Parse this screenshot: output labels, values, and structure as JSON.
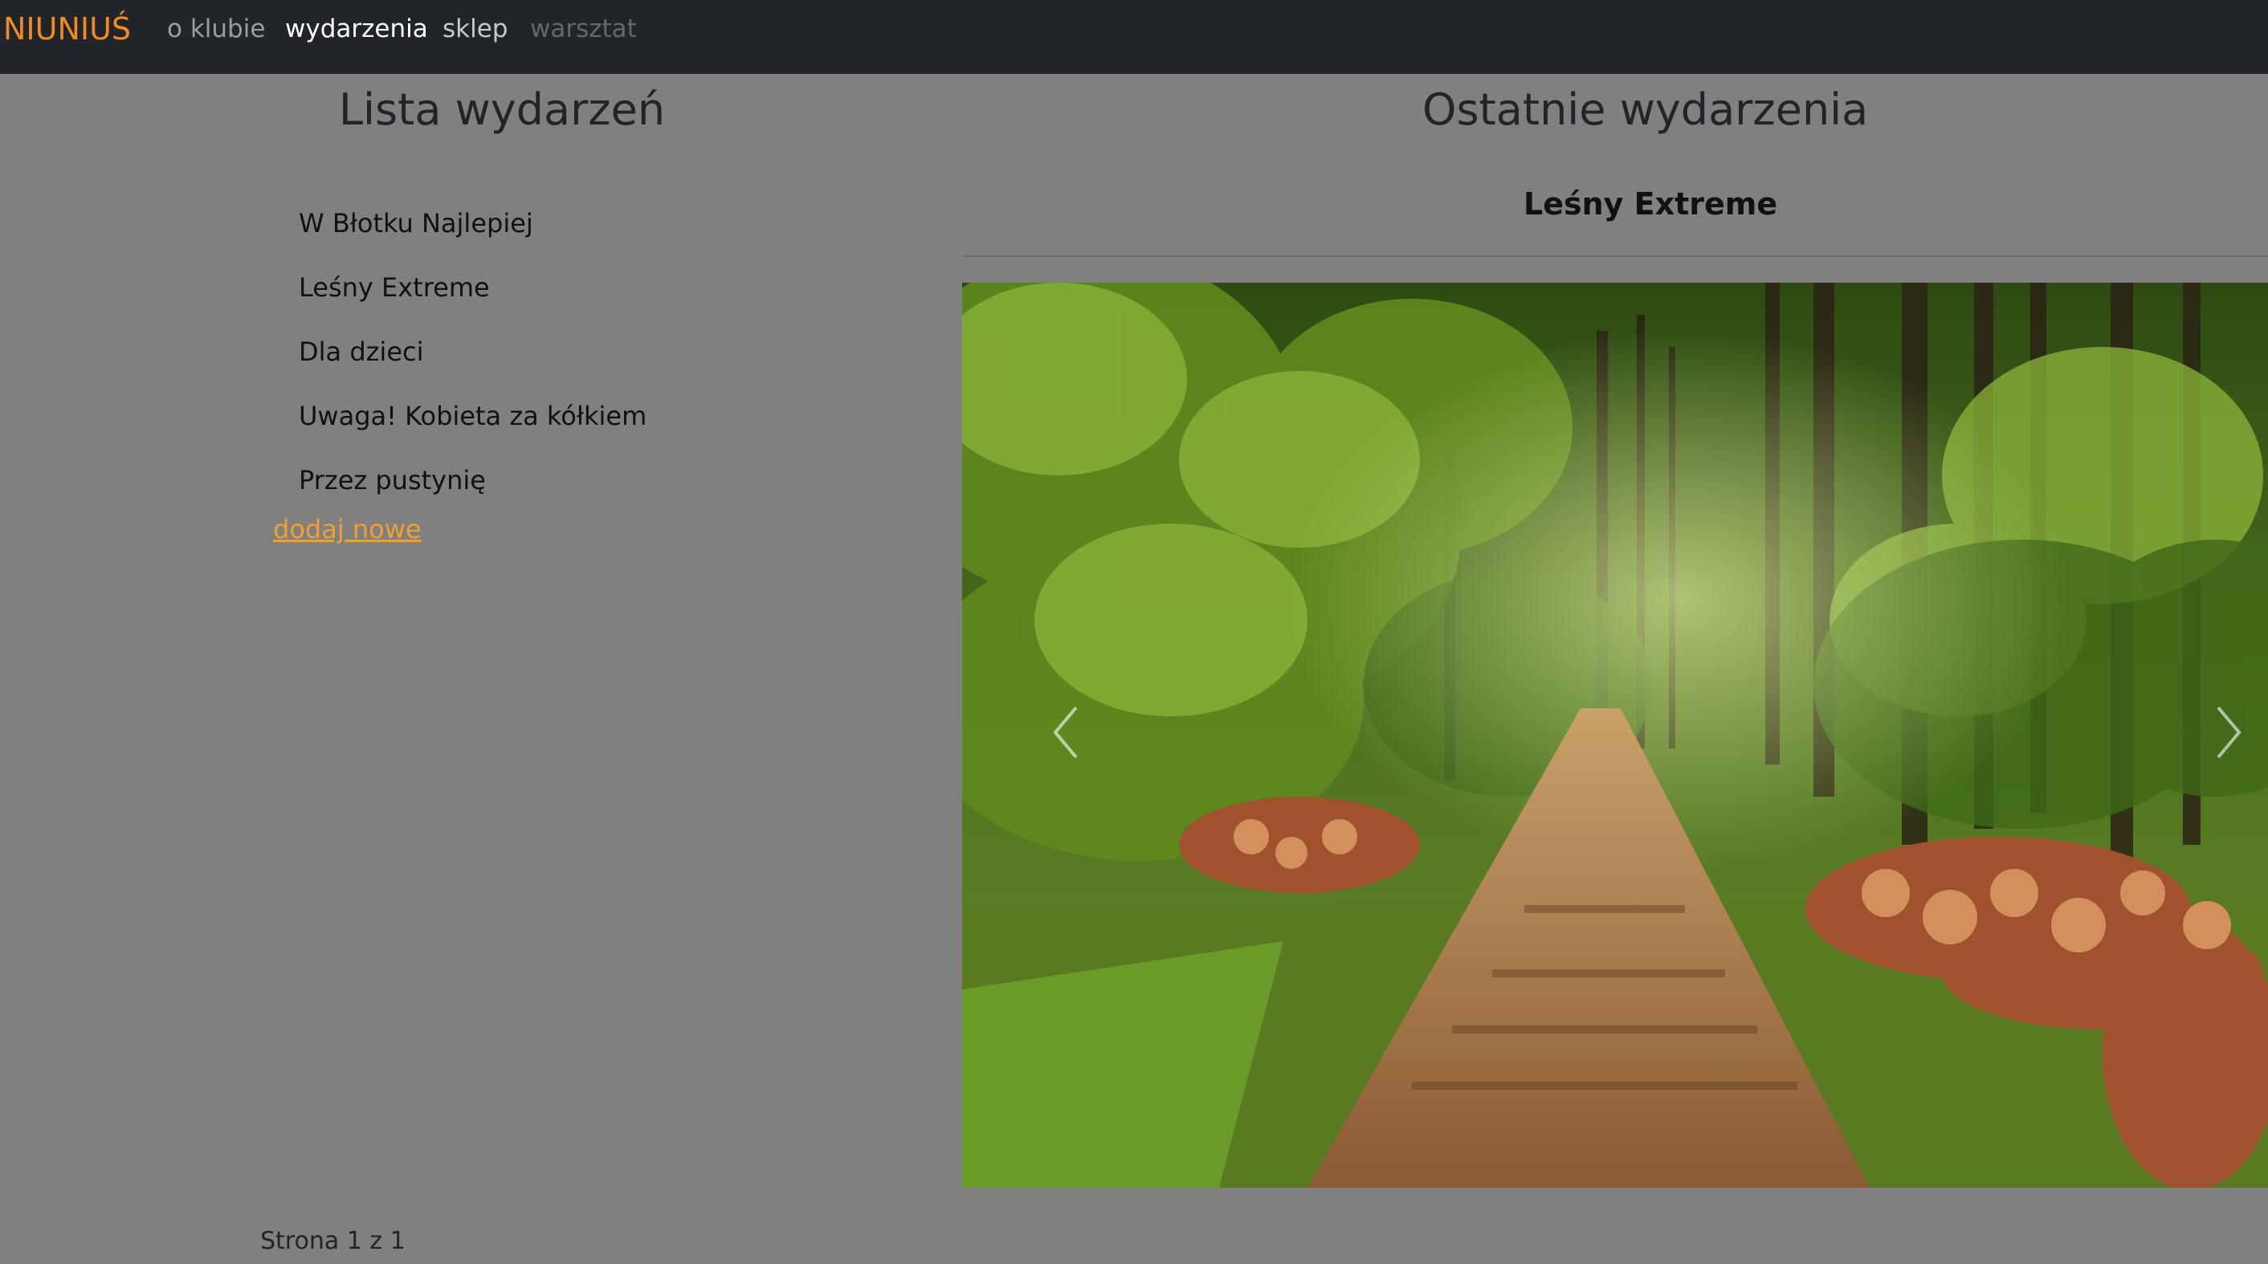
{
  "navbar": {
    "brand": "NIUNIUŚ",
    "links": [
      {
        "label": "o klubie"
      },
      {
        "label": "wydarzenia"
      },
      {
        "label": "sklep"
      },
      {
        "label": "warsztat"
      }
    ]
  },
  "events_list": {
    "title": "Lista wydarzeń",
    "items": [
      {
        "label": "W Błotku Najlepiej"
      },
      {
        "label": "Leśny Extreme"
      },
      {
        "label": "Dla dzieci"
      },
      {
        "label": "Uwaga! Kobieta za kółkiem"
      },
      {
        "label": "Przez pustynię"
      }
    ],
    "add_new": "dodaj nowe",
    "pagination": "Strona 1 z 1"
  },
  "recent": {
    "title": "Ostatnie wydarzenia",
    "card_title": "Leśny Extreme",
    "image": "forest-road-with-logs"
  },
  "colors": {
    "navbar_bg": "#212529",
    "page_bg": "#808080",
    "brand": "#f08a24",
    "link_accent": "#f0a030"
  }
}
